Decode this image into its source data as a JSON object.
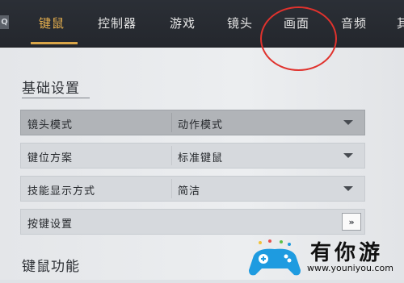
{
  "tabs": [
    {
      "label": "键鼠",
      "active": true
    },
    {
      "label": "控制器",
      "active": false
    },
    {
      "label": "游戏",
      "active": false
    },
    {
      "label": "镜头",
      "active": false
    },
    {
      "label": "画面",
      "active": false
    },
    {
      "label": "音频",
      "active": false
    },
    {
      "label": "其",
      "active": false
    }
  ],
  "corner_icon_text": "Q",
  "sections": {
    "basic": {
      "title": "基础设置"
    },
    "keyboard": {
      "title": "键鼠功能"
    }
  },
  "settings": [
    {
      "label": "镜头模式",
      "value": "动作模式",
      "control": "dropdown",
      "highlighted": true
    },
    {
      "label": "键位方案",
      "value": "标准键鼠",
      "control": "dropdown",
      "highlighted": false
    },
    {
      "label": "技能显示方式",
      "value": "简洁",
      "control": "dropdown",
      "highlighted": false
    },
    {
      "label": "按键设置",
      "button": "»",
      "control": "button",
      "highlighted": false
    }
  ],
  "annotation": {
    "color": "#e0322d",
    "target": "画面"
  },
  "watermark": {
    "text": "有你游",
    "url": "www.youniyou.com"
  },
  "colors": {
    "accent": "#e7b04e",
    "topbar": "#2b2f36"
  }
}
